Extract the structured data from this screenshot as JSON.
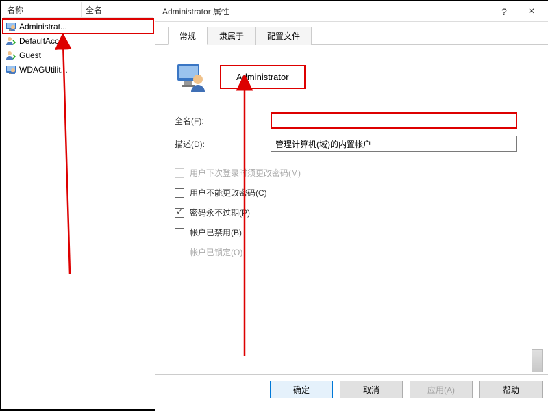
{
  "list": {
    "columns": {
      "name": "名称",
      "full": "全名"
    },
    "items": [
      {
        "label": "Administrat...",
        "selected": true
      },
      {
        "label": "DefaultAcc..."
      },
      {
        "label": "Guest"
      },
      {
        "label": "WDAGUtilit..."
      }
    ]
  },
  "dialog": {
    "title": "Administrator 属性",
    "help_symbol": "?",
    "close_symbol": "×",
    "tabs": [
      {
        "label": "常规",
        "active": true
      },
      {
        "label": "隶属于"
      },
      {
        "label": "配置文件"
      }
    ],
    "user_name": "Administrator",
    "fields": {
      "full_name": {
        "label": "全名(F):",
        "value": ""
      },
      "description": {
        "label": "描述(D):",
        "value": "管理计算机(域)的内置帐户"
      }
    },
    "checks": [
      {
        "label": "用户下次登录时须更改密码(M)",
        "checked": false,
        "disabled": true
      },
      {
        "label": "用户不能更改密码(C)",
        "checked": false,
        "disabled": false
      },
      {
        "label": "密码永不过期(P)",
        "checked": true,
        "disabled": false
      },
      {
        "label": "帐户已禁用(B)",
        "checked": false,
        "disabled": false
      },
      {
        "label": "帐户已锁定(O)",
        "checked": false,
        "disabled": true
      }
    ],
    "buttons": {
      "ok": "确定",
      "cancel": "取消",
      "apply": "应用(A)",
      "help": "帮助"
    }
  }
}
